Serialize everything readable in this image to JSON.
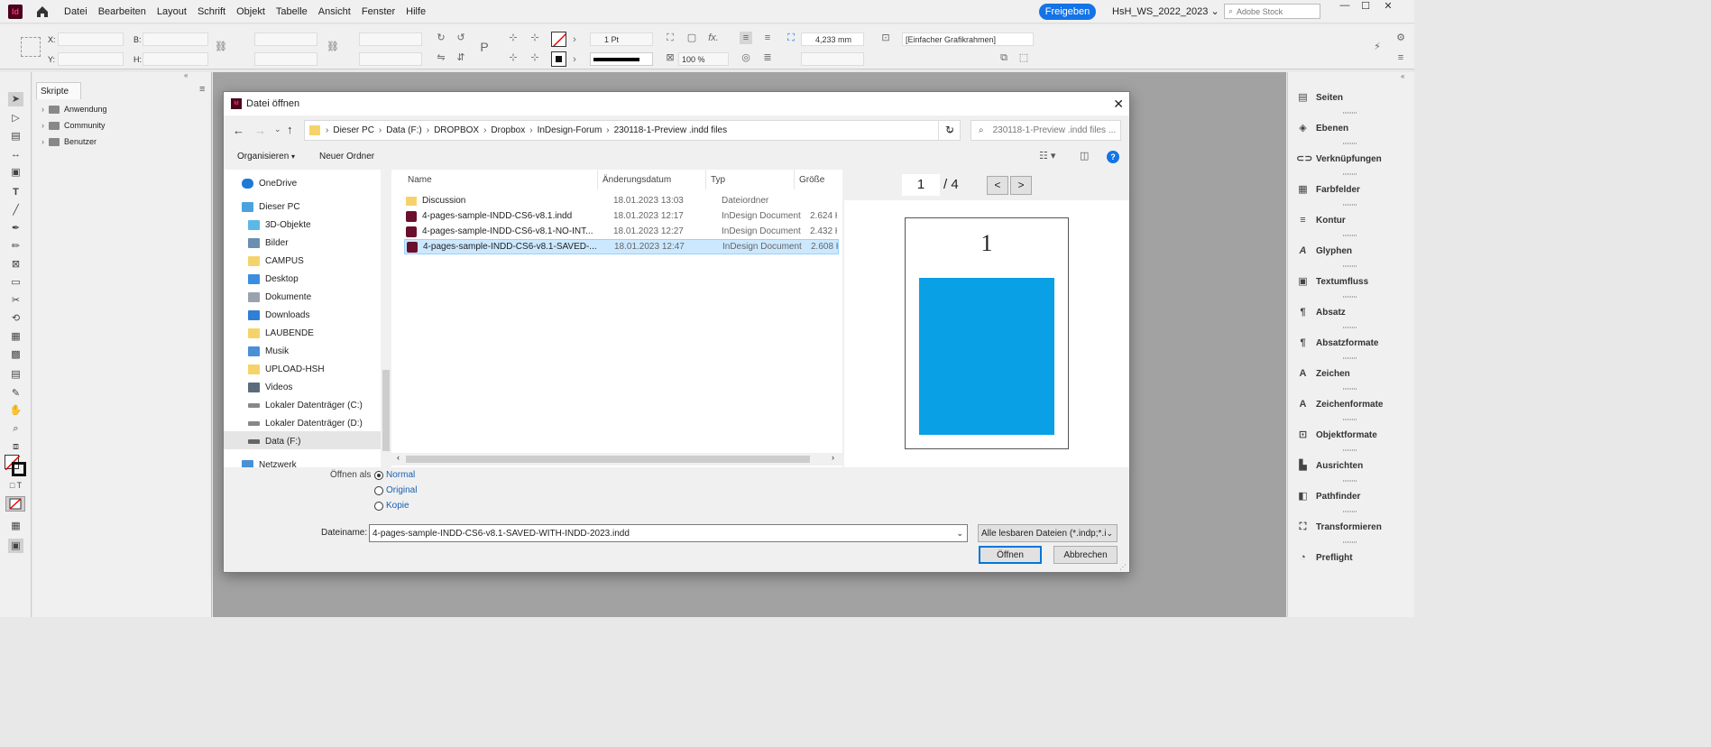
{
  "app": {
    "logo": "Id",
    "menu": [
      "Datei",
      "Bearbeiten",
      "Layout",
      "Schrift",
      "Objekt",
      "Tabelle",
      "Ansicht",
      "Fenster",
      "Hilfe"
    ],
    "share_label": "Freigeben",
    "workspace": "HsH_WS_2022_2023",
    "stock_placeholder": "Adobe Stock"
  },
  "controls": {
    "x_label": "X:",
    "y_label": "Y:",
    "w_label": "B:",
    "h_label": "H:",
    "stroke_weight": "1 Pt",
    "scale_percent": "100 %",
    "dimension": "4,233 mm",
    "frame_style": "[Einfacher Grafikrahmen]",
    "fx": "fx."
  },
  "scripts_panel": {
    "tab": "Skripte",
    "folders": [
      "Anwendung",
      "Community",
      "Benutzer"
    ]
  },
  "right_panels": [
    "Seiten",
    "Ebenen",
    "Verknüpfungen",
    "Farbfelder",
    "Kontur",
    "Glyphen",
    "Textumfluss",
    "Absatz",
    "Absatzformate",
    "Zeichen",
    "Zeichenformate",
    "Objektformate",
    "Ausrichten",
    "Pathfinder",
    "Transformieren",
    "Preflight"
  ],
  "dialog": {
    "title": "Datei öffnen",
    "breadcrumb": [
      "Dieser PC",
      "Data (F:)",
      "DROPBOX",
      "Dropbox",
      "InDesign-Forum",
      "230118-1-Preview .indd files"
    ],
    "search_placeholder": "230118-1-Preview .indd files ...",
    "organize": "Organisieren",
    "new_folder": "Neuer Ordner",
    "nav": [
      "OneDrive",
      "Dieser PC",
      "3D-Objekte",
      "Bilder",
      "CAMPUS",
      "Desktop",
      "Dokumente",
      "Downloads",
      "LAUBENDE",
      "Musik",
      "UPLOAD-HSH",
      "Videos",
      "Lokaler Datenträger (C:)",
      "Lokaler Datenträger (D:)",
      "Data (F:)",
      "Netzwerk"
    ],
    "columns": {
      "name": "Name",
      "date": "Änderungsdatum",
      "type": "Typ",
      "size": "Größe"
    },
    "files": [
      {
        "name": "Discussion",
        "date": "18.01.2023 13:03",
        "type": "Dateiordner",
        "size": ""
      },
      {
        "name": "4-pages-sample-INDD-CS6-v8.1.indd",
        "date": "18.01.2023 12:17",
        "type": "InDesign Document",
        "size": "2.624 K"
      },
      {
        "name": "4-pages-sample-INDD-CS6-v8.1-NO-INT...",
        "date": "18.01.2023 12:27",
        "type": "InDesign Document",
        "size": "2.432 K"
      },
      {
        "name": "4-pages-sample-INDD-CS6-v8.1-SAVED-...",
        "date": "18.01.2023 12:47",
        "type": "InDesign Document",
        "size": "2.608 K"
      }
    ],
    "preview": {
      "page": "1",
      "total": "/ 4",
      "page_number_label": "1",
      "prev": "<",
      "next": ">",
      "shape_color": "#0aa0e6"
    },
    "open_as_label": "Öffnen als",
    "open_as_options": [
      "Normal",
      "Original",
      "Kopie"
    ],
    "filename_label": "Dateiname:",
    "filename": "4-pages-sample-INDD-CS6-v8.1-SAVED-WITH-INDD-2023.indd",
    "filter": "Alle lesbaren Dateien (*.indp;*.i",
    "open_btn": "Öffnen",
    "cancel_btn": "Abbrechen"
  }
}
